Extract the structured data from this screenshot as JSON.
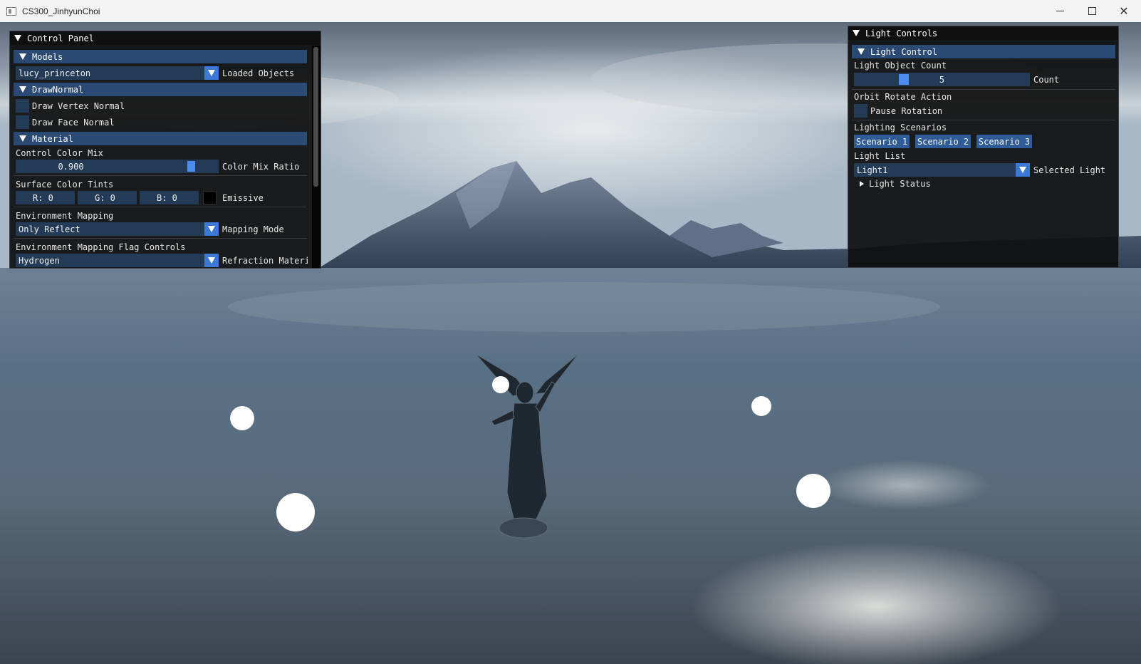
{
  "window": {
    "title": "CS300_JinhyunChoi"
  },
  "control_panel": {
    "title": "Control Panel",
    "models": {
      "header": "Models",
      "selected_model": "lucy_princeton",
      "combo_label": "Loaded Objects"
    },
    "draw_normal": {
      "header": "DrawNormal",
      "vertex_normal_label": "Draw Vertex Normal",
      "vertex_normal_checked": false,
      "face_normal_label": "Draw Face Normal",
      "face_normal_checked": false
    },
    "material": {
      "header": "Material",
      "color_mix_section": "Control Color Mix",
      "color_mix_value": "0.900",
      "color_mix_fraction": 0.9,
      "color_mix_label": "Color Mix Ratio",
      "tints_section": "Surface Color Tints",
      "r_field": "R:  0",
      "g_field": "G:  0",
      "b_field": "B:  0",
      "emissive_label": "Emissive",
      "emissive_color": "#000000",
      "env_mapping_section": "Environment Mapping",
      "env_mapping_value": "Only Reflect",
      "env_mapping_label": "Mapping Mode",
      "flag_controls_section": "Environment Mapping Flag Controls",
      "refraction_value": "Hydrogen",
      "refraction_label": "Refraction Materia"
    }
  },
  "light_controls": {
    "title": "Light Controls",
    "header": "Light Control",
    "count_section": "Light Object Count",
    "count_value": "5",
    "count_label": "Count",
    "orbit_section": "Orbit Rotate Action",
    "pause_label": "Pause Rotation",
    "pause_checked": false,
    "scenarios_section": "Lighting Scenarios",
    "scenarios": [
      "Scenario 1",
      "Scenario 2",
      "Scenario 3"
    ],
    "list_section": "Light List",
    "selected_light": "Light1",
    "selected_light_label": "Selected Light",
    "status_node": "Light Status"
  },
  "colors": {
    "header_bg": "#2a4a73",
    "frame_bg": "#243b58",
    "accent": "#4d8cf0",
    "button_bg": "#2f5c98"
  },
  "icons": [
    "app-icon",
    "minimize-icon",
    "maximize-icon",
    "close-icon",
    "collapse-arrow-icon",
    "combo-arrow-icon",
    "tree-expand-icon"
  ]
}
